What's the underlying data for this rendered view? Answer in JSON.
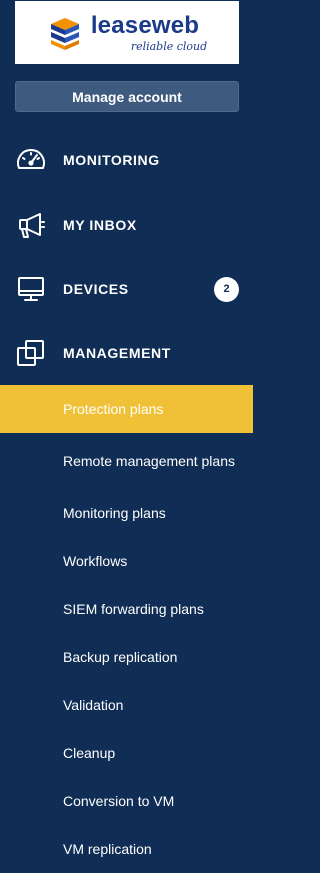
{
  "logo": {
    "word": "leaseweb",
    "tagline": "reliable cloud"
  },
  "manage_account": {
    "label": "Manage account"
  },
  "nav": [
    {
      "label": "MONITORING",
      "icon": "gauge-icon"
    },
    {
      "label": "MY INBOX",
      "icon": "megaphone-icon"
    },
    {
      "label": "DEVICES",
      "icon": "monitor-icon",
      "badge": "2"
    },
    {
      "label": "MANAGEMENT",
      "icon": "overlapping-squares-icon"
    }
  ],
  "submenu": {
    "items": [
      {
        "label": "Protection plans",
        "active": true
      },
      {
        "label": "Remote management plans"
      },
      {
        "label": "Monitoring plans"
      },
      {
        "label": "Workflows"
      },
      {
        "label": "SIEM forwarding plans"
      },
      {
        "label": "Backup replication"
      },
      {
        "label": "Validation"
      },
      {
        "label": "Cleanup"
      },
      {
        "label": "Conversion to VM"
      },
      {
        "label": "VM replication"
      }
    ]
  },
  "colors": {
    "sidebar_bg": "#0f2d55",
    "active_bg": "#f0c136",
    "button_bg": "#3e5a7e",
    "logo_blue": "#1b3a8a",
    "logo_orange": "#f39200"
  }
}
